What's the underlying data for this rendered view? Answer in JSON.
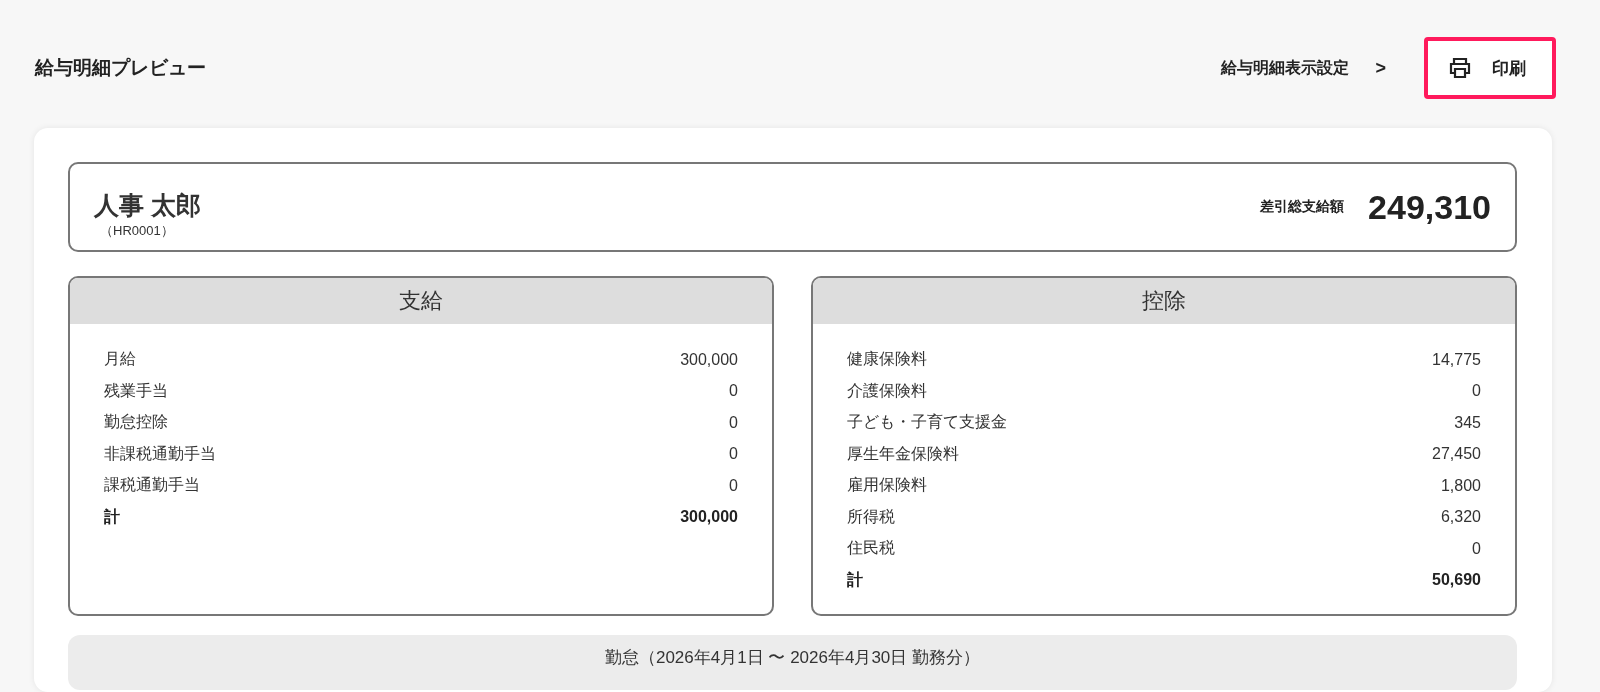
{
  "page_title": "給与明細プレビュー",
  "settings_link": {
    "label": "給与明細表示設定",
    "arrow": ">"
  },
  "print_button": {
    "label": "印刷"
  },
  "employee": {
    "name": "人事 太郎",
    "code": "（HR0001）",
    "net_pay_label": "差引総支給額",
    "net_pay": "249,310"
  },
  "panels": [
    {
      "title": "支給",
      "rows": [
        {
          "label": "月給",
          "value": "300,000",
          "kind": "item"
        },
        {
          "label": "残業手当",
          "value": "0",
          "kind": "item"
        },
        {
          "label": "勤怠控除",
          "value": "0",
          "kind": "item"
        },
        {
          "label": "非課税通勤手当",
          "value": "0",
          "kind": "item"
        },
        {
          "label": "課税通勤手当",
          "value": "0",
          "kind": "item"
        },
        {
          "label": "計",
          "value": "300,000",
          "kind": "total"
        }
      ]
    },
    {
      "title": "控除",
      "rows": [
        {
          "label": "健康保険料",
          "value": "14,775",
          "kind": "item"
        },
        {
          "label": "介護保険料",
          "value": "0",
          "kind": "item"
        },
        {
          "label": "子ども・子育て支援金",
          "value": "345",
          "kind": "item"
        },
        {
          "label": "厚生年金保険料",
          "value": "27,450",
          "kind": "item"
        },
        {
          "label": "雇用保険料",
          "value": "1,800",
          "kind": "item"
        },
        {
          "label": "所得税",
          "value": "6,320",
          "kind": "item"
        },
        {
          "label": "住民税",
          "value": "0",
          "kind": "item"
        },
        {
          "label": "計",
          "value": "50,690",
          "kind": "total"
        }
      ]
    }
  ],
  "attendance": {
    "title": "勤怠（2026年4月1日 〜 2026年4月30日 勤務分）"
  }
}
